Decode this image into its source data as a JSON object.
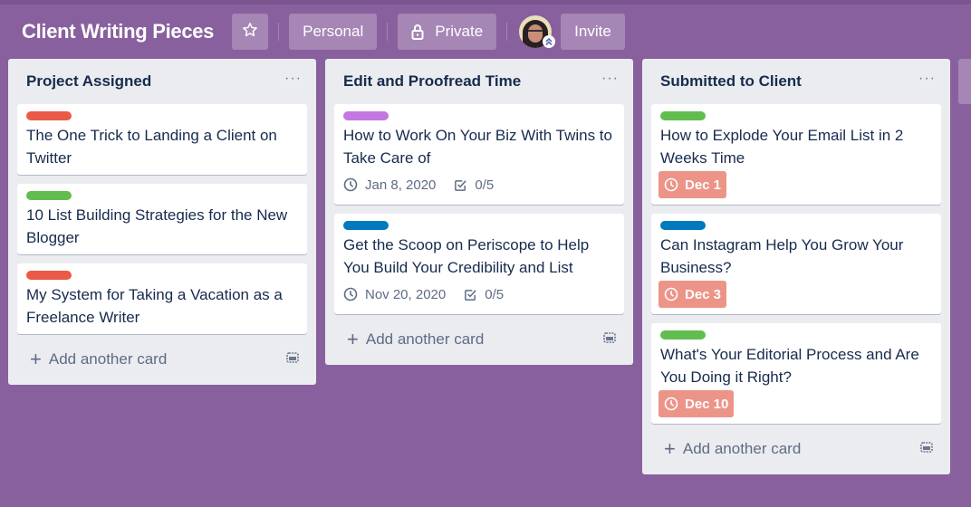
{
  "header": {
    "board_title": "Client Writing Pieces",
    "star_icon": "star-icon",
    "personal_label": "Personal",
    "private_label": "Private",
    "lock_icon": "lock-icon",
    "invite_label": "Invite"
  },
  "colors": {
    "board_bg": "#89609e",
    "label_red": "#eb5a46",
    "label_green": "#61bd4f",
    "label_purple": "#c377e0",
    "label_blue": "#0079bf",
    "due_overdue": "#ec9488"
  },
  "lists": [
    {
      "title": "Project Assigned",
      "menu_icon": "more-icon",
      "cards": [
        {
          "label_color": "#eb5a46",
          "title": "The One Trick to Landing a Client on Twitter"
        },
        {
          "label_color": "#61bd4f",
          "title": "10 List Building Strategies for the New Blogger"
        },
        {
          "label_color": "#eb5a46",
          "title": "My System for Taking a Vacation as a Freelance Writer"
        }
      ],
      "add_card_label": "Add another card"
    },
    {
      "title": "Edit and Proofread Time",
      "menu_icon": "more-icon",
      "cards": [
        {
          "label_color": "#c377e0",
          "title": "How to Work On Your Biz With Twins to Take Care of",
          "due": "Jan 8, 2020",
          "checklist": "0/5"
        },
        {
          "label_color": "#0079bf",
          "title": "Get the Scoop on Periscope to Help You Build Your Credibility and List",
          "due": "Nov 20, 2020",
          "checklist": "0/5"
        }
      ],
      "add_card_label": "Add another card"
    },
    {
      "title": "Submitted to Client",
      "menu_icon": "more-icon",
      "cards": [
        {
          "label_color": "#61bd4f",
          "title": "How to Explode Your Email List in 2 Weeks Time",
          "due": "Dec 1",
          "due_status": "overdue"
        },
        {
          "label_color": "#0079bf",
          "title": "Can Instagram Help You Grow Your Business?",
          "due": "Dec 3",
          "due_status": "overdue"
        },
        {
          "label_color": "#61bd4f",
          "title": "What's Your Editorial Process and Are You Doing it Right?",
          "due": "Dec 10",
          "due_status": "overdue"
        }
      ],
      "add_card_label": "Add another card"
    }
  ]
}
